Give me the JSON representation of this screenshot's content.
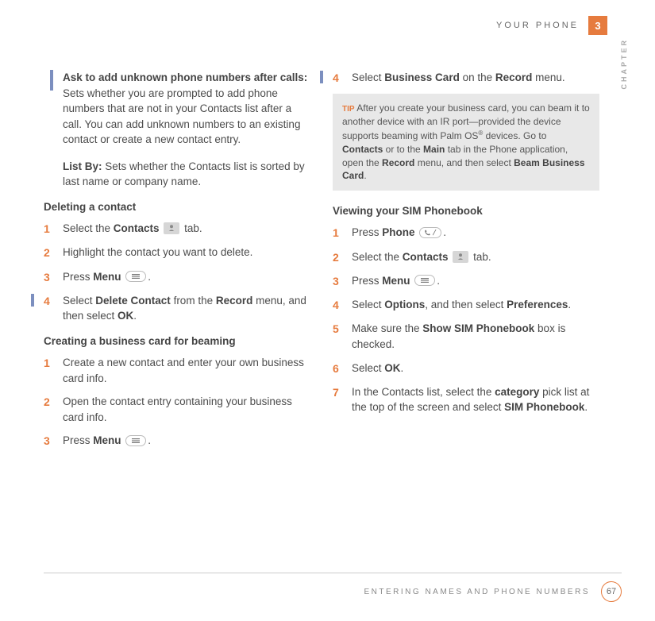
{
  "header": {
    "title": "YOUR PHONE",
    "chapter": "3",
    "chapter_label": "CHAPTER"
  },
  "footer": {
    "title": "ENTERING NAMES AND PHONE NUMBERS",
    "page": "67"
  },
  "left": {
    "ask_bold": "Ask to add unknown phone numbers after calls:",
    "ask_text": " Sets whether you are prompted to add phone numbers that are not in your Contacts list after a call. You can add unknown numbers to an existing contact or create a new contact entry.",
    "listby_bold": "List By:",
    "listby_text": " Sets whether the Contacts list is sorted by last name or company name.",
    "del_heading": "Deleting a contact",
    "del_steps": [
      {
        "n": "1",
        "pre": "Select the ",
        "b1": "Contacts ",
        "icon": "contacts",
        "post": " tab."
      },
      {
        "n": "2",
        "text": "Highlight the contact you want to delete."
      },
      {
        "n": "3",
        "pre": "Press ",
        "b1": "Menu ",
        "icon": "menu",
        "post": "."
      },
      {
        "n": "4",
        "pre": "Select ",
        "b1": "Delete Contact",
        "mid": " from the ",
        "b2": "Record",
        "mid2": " menu, and then select ",
        "b3": "OK",
        "post": "."
      }
    ],
    "biz_heading": "Creating a business card for beaming",
    "biz_steps": [
      {
        "n": "1",
        "text": "Create a new contact and enter your own business card info."
      },
      {
        "n": "2",
        "text": "Open the contact entry containing your business card info."
      },
      {
        "n": "3",
        "pre": "Press ",
        "b1": "Menu ",
        "icon": "menu",
        "post": "."
      }
    ]
  },
  "right": {
    "step4": {
      "n": "4",
      "pre": "Select ",
      "b1": "Business Card",
      "mid": " on the ",
      "b2": "Record",
      "post": " menu."
    },
    "tip_label": "TIP",
    "tip_seg1": " After you create your business card, you can beam it to another device with an IR port—provided the device supports beaming with Palm OS",
    "tip_reg": "®",
    "tip_seg2": " devices. Go to ",
    "tip_b1": "Contacts",
    "tip_seg3": " or to the ",
    "tip_b2": "Main",
    "tip_seg4": " tab in the Phone application, open the ",
    "tip_b3": "Record",
    "tip_seg5": " menu, and then select ",
    "tip_b4": "Beam Business Card",
    "tip_seg6": ".",
    "sim_heading": "Viewing your SIM Phonebook",
    "sim_steps": [
      {
        "n": "1",
        "pre": "Press ",
        "b1": "Phone ",
        "icon": "phone",
        "post": "."
      },
      {
        "n": "2",
        "pre": "Select the ",
        "b1": "Contacts ",
        "icon": "contacts",
        "post": " tab."
      },
      {
        "n": "3",
        "pre": "Press ",
        "b1": "Menu ",
        "icon": "menu",
        "post": "."
      },
      {
        "n": "4",
        "pre": "Select ",
        "b1": "Options",
        "mid": ", and then select ",
        "b2": "Preferences",
        "post": "."
      },
      {
        "n": "5",
        "pre": "Make sure the ",
        "b1": "Show SIM Phonebook",
        "post": " box is checked."
      },
      {
        "n": "6",
        "pre": "Select ",
        "b1": "OK",
        "post": "."
      },
      {
        "n": "7",
        "pre": "In the Contacts list, select the ",
        "b1": "category",
        "mid": " pick list at the top of the screen and select ",
        "b2": "SIM Phonebook",
        "post": "."
      }
    ]
  }
}
